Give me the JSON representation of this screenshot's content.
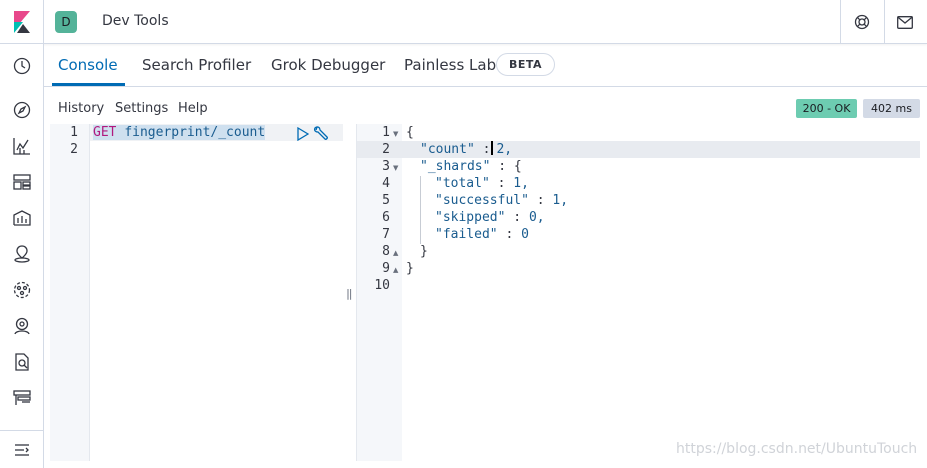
{
  "header": {
    "space_initial": "D",
    "app_title": "Dev Tools",
    "icons": [
      "kibana-logo-icon",
      "help-lifebuoy-icon",
      "mail-icon"
    ]
  },
  "sidenav": {
    "icons": [
      "recent-clock-icon",
      "discover-compass-icon",
      "visualize-chart-icon",
      "dashboard-icon",
      "canvas-icon",
      "maps-icon",
      "ml-icon",
      "metrics-icon",
      "logs-icon",
      "apm-icon",
      "collapse-menu-icon"
    ]
  },
  "tabs": [
    {
      "label": "Console",
      "active": true
    },
    {
      "label": "Search Profiler",
      "active": false
    },
    {
      "label": "Grok Debugger",
      "active": false
    },
    {
      "label": "Painless Lab",
      "active": false
    }
  ],
  "beta_badge": "BETA",
  "toolbar": {
    "history": "History",
    "settings": "Settings",
    "help": "Help"
  },
  "status": {
    "code": "200 - OK",
    "time": "402 ms",
    "ok_color": "#6dccb1"
  },
  "request": {
    "line_numbers": [
      "1",
      "2"
    ],
    "method": "GET",
    "path": "fingerprint/_count"
  },
  "response": {
    "line_numbers": [
      "1",
      "2",
      "3",
      "4",
      "5",
      "6",
      "7",
      "8",
      "9",
      "10"
    ],
    "open_brace": "{",
    "count_key": "\"count\"",
    "count_value": "2,",
    "shards_key": "\"_shards\"",
    "shards_open": ": {",
    "total_key": "\"total\"",
    "total_value": "1,",
    "successful_key": "\"successful\"",
    "successful_value": "1,",
    "skipped_key": "\"skipped\"",
    "skipped_value": "0,",
    "failed_key": "\"failed\"",
    "failed_value": "0",
    "inner_close": "}",
    "outer_close": "}",
    "colon": ":"
  },
  "watermark": "https://blog.csdn.net/UbuntuTouch"
}
